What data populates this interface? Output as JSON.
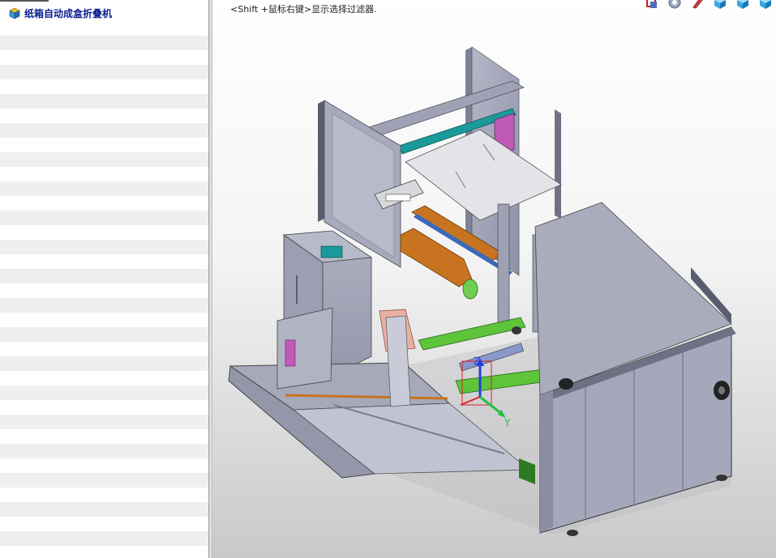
{
  "feature_tree": {
    "root_label": "纸箱自动成盒折叠机",
    "root_icon": "assembly-icon"
  },
  "graphics_area": {
    "hint_text": "<Shift +鼠标右键>显示选择过滤器.",
    "toolbar_icons": [
      "rotate-view-icon",
      "view-settings-icon",
      "edit-appearance-icon",
      "display-style-icon",
      "view-orientation-icon",
      "section-view-icon"
    ],
    "triad_labels": {
      "z": "Z",
      "y": "Y"
    },
    "colors": {
      "frame_gray": "#a4a7b8",
      "panel_dark": "#6e7184",
      "teal_bar": "#1a9a9a",
      "orange_belt": "#c8731f",
      "green_rail": "#5ec43a",
      "magenta_part": "#c05ab8",
      "yellow_bar": "#e8e05a",
      "cyan_rod": "#38c8c8",
      "triad_z": "#2040e0",
      "triad_y": "#20c040"
    }
  }
}
